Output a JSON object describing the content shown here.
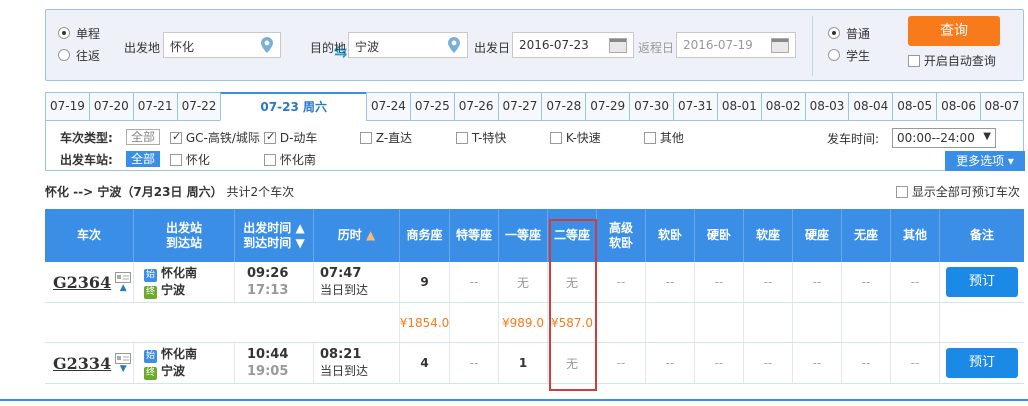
{
  "search": {
    "trip_type": {
      "oneway": "单程",
      "roundtrip": "往返"
    },
    "from_label": "出发地",
    "from_value": "怀化",
    "to_label": "目的地",
    "to_value": "宁波",
    "depart_label": "出发日",
    "depart_value": "2016-07-23",
    "return_label": "返程日",
    "return_value": "2016-07-19",
    "passenger": {
      "normal": "普通",
      "student": "学生"
    },
    "query_label": "查询",
    "auto_query_label": "开启自动查询"
  },
  "date_tabs": [
    "07-19",
    "07-20",
    "07-21",
    "07-22",
    "07-23 周六",
    "07-24",
    "07-25",
    "07-26",
    "07-27",
    "07-28",
    "07-29",
    "07-30",
    "07-31",
    "08-01",
    "08-02",
    "08-03",
    "08-04",
    "08-05",
    "08-06",
    "08-07"
  ],
  "filters": {
    "train_type_label": "车次类型:",
    "all_label": "全部",
    "types": [
      "GC-高铁/城际",
      "D-动车",
      "Z-直达",
      "T-特快",
      "K-快速",
      "其他"
    ],
    "station_label": "出发车站:",
    "stations": [
      "怀化",
      "怀化南"
    ],
    "time_label": "发车时间:",
    "time_value": "00:00--24:00",
    "more_label": "更多选项 ▾"
  },
  "summary": {
    "route": "怀化 --> 宁波（7月23日  周六）",
    "count": "共计2个车次",
    "show_all": "显示全部可预订车次"
  },
  "table": {
    "headers": {
      "train": "车次",
      "station_from": "出发站",
      "station_to": "到达站",
      "time_dep": "出发时间",
      "time_arr": "到达时间",
      "duration": "历时",
      "business": "商务座",
      "premium": "特等座",
      "first": "一等座",
      "second": "二等座",
      "adv_soft_1": "高级",
      "adv_soft_2": "软卧",
      "soft_sleeper": "软卧",
      "hard_sleeper": "硬卧",
      "soft_seat": "软座",
      "hard_seat": "硬座",
      "no_seat": "无座",
      "other": "其他",
      "remark": "备注"
    },
    "rows": [
      {
        "train": "G2364",
        "from": "怀化南",
        "to": "宁波",
        "badge_start": "始",
        "badge_end": "终",
        "dep": "09:26",
        "arr": "17:13",
        "duration": "07:47",
        "arrive_note": "当日到达",
        "business": "9",
        "premium": "--",
        "first": "无",
        "second": "无",
        "adv": "--",
        "soft": "--",
        "hard": "--",
        "softseat": "--",
        "hardseat": "--",
        "noseat": "--",
        "other": "--",
        "book": "预订",
        "prices": {
          "business": "¥1854.0",
          "first": "¥989.0",
          "second": "¥587.0"
        }
      },
      {
        "train": "G2334",
        "from": "怀化南",
        "to": "宁波",
        "badge_start": "始",
        "badge_end": "终",
        "dep": "10:44",
        "arr": "19:05",
        "duration": "08:21",
        "arrive_note": "当日到达",
        "business": "4",
        "premium": "--",
        "first": "1",
        "second": "无",
        "adv": "--",
        "soft": "--",
        "hard": "--",
        "softseat": "--",
        "hardseat": "--",
        "noseat": "--",
        "other": "--",
        "book": "预订"
      }
    ]
  }
}
